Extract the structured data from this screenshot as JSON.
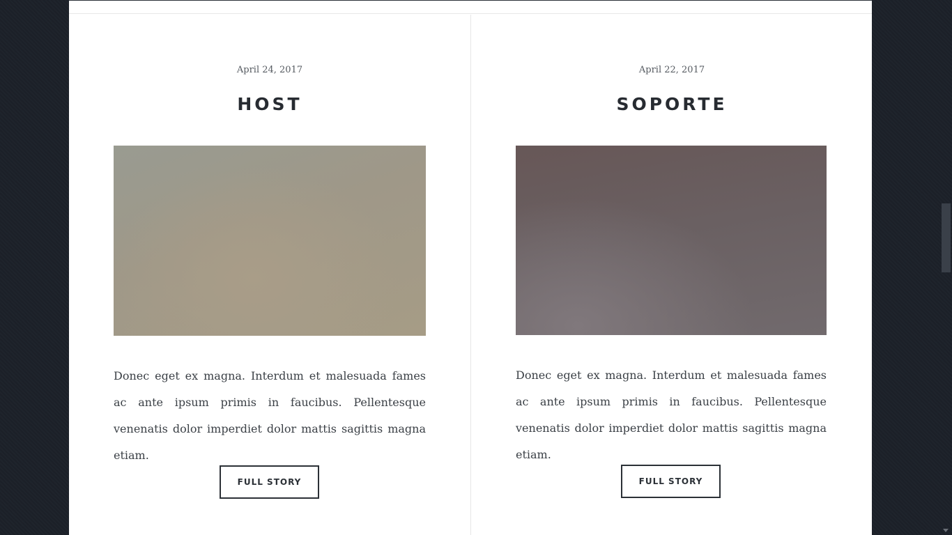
{
  "posts": [
    {
      "date": "April 24, 2017",
      "title": "HOST",
      "body": "Donec eget ex magna. Interdum et malesuada fames ac ante ipsum primis in faucibus. Pellentesque venenatis dolor imperdiet dolor mattis sagittis magna etiam.",
      "button_label": "FULL STORY"
    },
    {
      "date": "April 22, 2017",
      "title": "SOPORTE",
      "body": "Donec eget ex magna. Interdum et malesuada fames ac ante ipsum primis in faucibus. Pellentesque venenatis dolor imperdiet dolor mattis sagittis magna etiam.",
      "button_label": "FULL STORY"
    }
  ],
  "scrollbar": {
    "position_fraction": 0.38
  }
}
